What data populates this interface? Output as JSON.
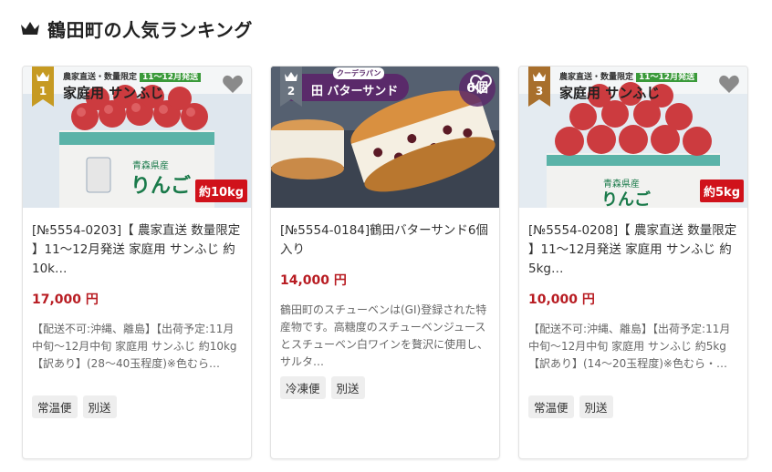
{
  "section": {
    "title": "鶴田町の人気ランキング",
    "icon": "crown-icon",
    "crown_color": "#222222"
  },
  "colors": {
    "price": "#b81c22",
    "rank_gold": "#c69a22",
    "weight_tag": "#d0121b",
    "tag_bg": "#eeeeee"
  },
  "products": [
    {
      "rank": "1",
      "banner_top": "農家直送・数量限定",
      "banner_period": "11〜12月発送",
      "banner_main": "家庭用 サンふじ",
      "weight_tag": "約10kg",
      "title": "[№5554-0203]【 農家直送 数量限定 】11～12月発送 家庭用 サンふじ 約 10k…",
      "price": "17,000 円",
      "description": "【配送不可:沖縄、離島】【出荷予定:11月中旬～12月中旬 家庭用 サンふじ 約10kg【訳あり】(28～40玉程度)※色むら…",
      "tags": [
        "常温便",
        "別送"
      ]
    },
    {
      "rank": "2",
      "banner_sub": "クーデラパン",
      "banner_main": "田 バターサンド",
      "count_label": "6個",
      "title": "[№5554-0184]鶴田バターサンド6個入り",
      "price": "14,000 円",
      "description": "鶴田町のスチューベンは(GI)登録された特産物です。高糖度のスチューベンジュースとスチューベン白ワインを贅沢に使用し、サルタ…",
      "tags": [
        "冷凍便",
        "別送"
      ]
    },
    {
      "rank": "3",
      "banner_top": "農家直送・数量限定",
      "banner_period": "11〜12月発送",
      "banner_main": "家庭用 サンふじ",
      "weight_tag": "約5kg",
      "title": "[№5554-0208]【 農家直送 数量限定 】11～12月発送 家庭用 サンふじ 約 5kg…",
      "price": "10,000 円",
      "description": "【配送不可:沖縄、離島】【出荷予定:11月中旬～12月中旬 家庭用 サンふじ 約5kg【訳あり】(14～20玉程度)※色むら・…",
      "tags": [
        "常温便",
        "別送"
      ]
    }
  ]
}
